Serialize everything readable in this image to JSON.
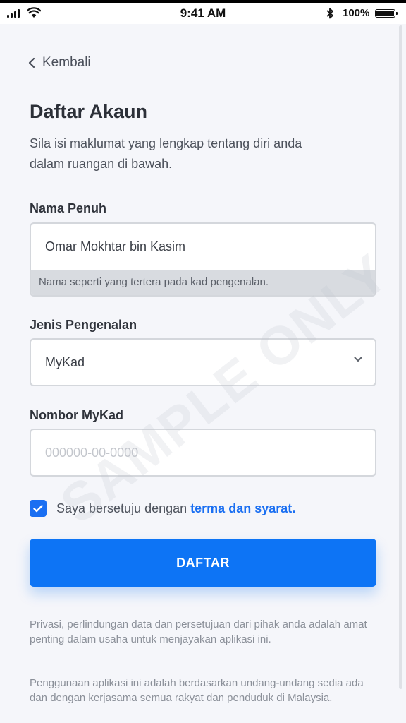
{
  "status_bar": {
    "time": "9:41 AM",
    "battery": "100%"
  },
  "nav": {
    "back_label": "Kembali"
  },
  "header": {
    "title": "Daftar Akaun",
    "subtitle": "Sila isi maklumat yang lengkap tentang diri anda dalam ruangan di bawah."
  },
  "form": {
    "name_label": "Nama Penuh",
    "name_value": "Omar Mokhtar bin Kasim",
    "name_helper": "Nama seperti yang tertera pada kad pengenalan.",
    "id_type_label": "Jenis Pengenalan",
    "id_type_value": "MyKad",
    "id_number_label": "Nombor MyKad",
    "id_number_placeholder": "000000-00-0000",
    "agree_text": "Saya bersetuju dengan",
    "terms_link": "terma dan syarat.",
    "submit_label": "DAFTAR"
  },
  "footer": {
    "privacy_text": "Privasi, perlindungan data dan persetujuan dari pihak anda adalah amat penting dalam usaha untuk menjayakan aplikasi ini.",
    "legal_text": "Penggunaan aplikasi ini adalah berdasarkan undang-undang sedia ada dan dengan kerjasama semua rakyat dan penduduk di Malaysia."
  },
  "watermark": "SAMPLE ONLY",
  "colors": {
    "accent": "#0d74f5",
    "background": "#f5f6fa"
  }
}
